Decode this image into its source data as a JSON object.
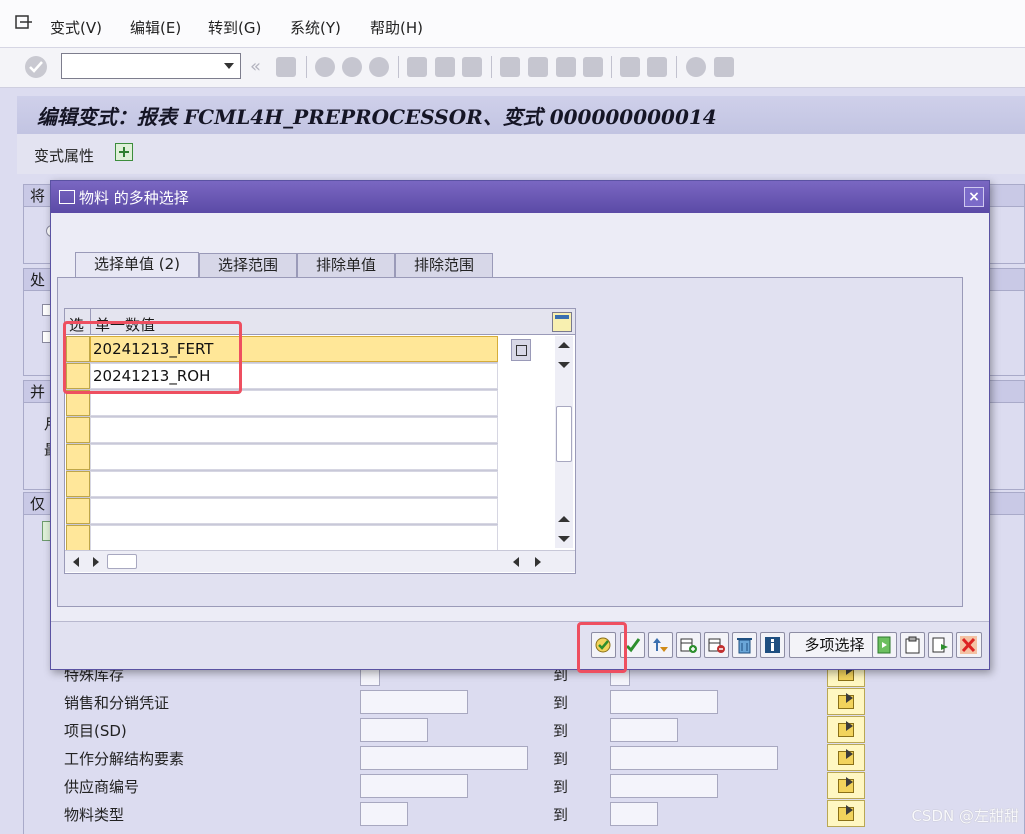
{
  "menu": {
    "items": [
      "变式(V)",
      "编辑(E)",
      "转到(G)",
      "系统(Y)",
      "帮助(H)"
    ]
  },
  "toolbar": {
    "command_value": "",
    "chevron": "«",
    "icons": [
      "ok-icon",
      "save-icon",
      "back-icon",
      "exit-icon",
      "cancel-icon",
      "print-icon",
      "find-icon",
      "find-next-icon",
      "first-page-icon",
      "previous-page-icon",
      "next-page-icon",
      "last-page-icon",
      "new-session-icon",
      "shortcut-icon",
      "help-icon",
      "layout-icon"
    ]
  },
  "page": {
    "title": "编辑变式：报表 FCML4H_PREPROCESSOR、变式 000000000014",
    "variant_attributes": "变式属性"
  },
  "background": {
    "group_fragments": [
      "将",
      "处",
      "并",
      "仅"
    ],
    "sub_fragments": [
      "月",
      "最"
    ],
    "rows": [
      {
        "label": "特殊库存",
        "to": "到"
      },
      {
        "label": "销售和分销凭证",
        "to": "到"
      },
      {
        "label": "项目(SD)",
        "to": "到"
      },
      {
        "label": "工作分解结构要素",
        "to": "到"
      },
      {
        "label": "供应商编号",
        "to": "到"
      },
      {
        "label": "物料类型",
        "to": "到"
      }
    ]
  },
  "dialog": {
    "title": "物料 的多种选择",
    "close": "×",
    "tabs": [
      "选择单值 (2)",
      "选择范围",
      "排除单值",
      "排除范围"
    ],
    "grid": {
      "col_select": "选",
      "col_value": "单一数值",
      "rows": [
        "20241213_FERT",
        "20241213_ROH",
        "",
        "",
        "",
        "",
        "",
        ""
      ]
    },
    "buttons": {
      "multi_select": "多项选择",
      "icons": [
        "execute-icon",
        "check-icon",
        "sort-icon",
        "insert-line-icon",
        "delete-line-icon",
        "delete-all-icon",
        "info-icon",
        "import-file-icon",
        "upload-clipboard-icon",
        "copy-icon",
        "cancel-icon"
      ]
    }
  },
  "watermark": "CSDN @左甜甜",
  "colors": {
    "title_bar": "#5b4aa6",
    "highlight_box": "#ee4f60",
    "selected_row": "#ffe798",
    "background": "#dcdcf0"
  }
}
